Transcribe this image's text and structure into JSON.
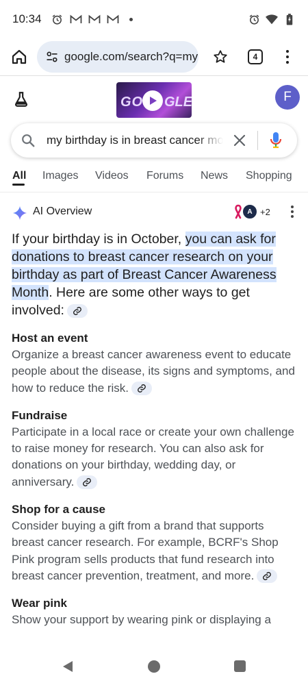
{
  "status_bar": {
    "time": "10:34",
    "left_icons": [
      "alarm-icon",
      "gmail-icon",
      "gmail-icon",
      "gmail-icon",
      "dot-icon"
    ],
    "right_icons": [
      "alarm-icon",
      "wifi-icon",
      "battery-icon"
    ]
  },
  "browser": {
    "url": "google.com/search?q=my",
    "tab_count": "4"
  },
  "header": {
    "avatar_initial": "F",
    "doodle_text_left": "GO",
    "doodle_text_right": "GLE"
  },
  "search": {
    "query": "my birthday is in breast cancer month"
  },
  "tabs": [
    {
      "label": "All",
      "active": true
    },
    {
      "label": "Images",
      "active": false
    },
    {
      "label": "Videos",
      "active": false
    },
    {
      "label": "Forums",
      "active": false
    },
    {
      "label": "News",
      "active": false
    },
    {
      "label": "Shopping",
      "active": false
    }
  ],
  "ai_overview": {
    "title": "AI Overview",
    "source_badge": "A",
    "source_more": "+2",
    "lead_before": "If your birthday is in October, ",
    "lead_highlight": "you can ask for donations to breast cancer research on your birthday as part of Breast Cancer Awareness Month",
    "lead_after": ". Here are some other ways to get involved:",
    "sections": [
      {
        "title": "Host an event",
        "body": "Organize a breast cancer awareness event to educate people about the disease, its signs and symptoms, and how to reduce the risk."
      },
      {
        "title": "Fundraise",
        "body": "Participate in a local race or create your own challenge to raise money for research. You can also ask for donations on your birthday, wedding day, or anniversary."
      },
      {
        "title": "Shop for a cause",
        "body": "Consider buying a gift from a brand that supports breast cancer research. For example, BCRF's Shop Pink program sells products that fund research into breast cancer prevention, treatment, and more."
      },
      {
        "title": "Wear pink",
        "body": "Show your support by wearing pink or displaying a"
      }
    ]
  },
  "colors": {
    "highlight": "#d3e3fd",
    "avatar": "#5d5fc9",
    "url_pill": "#e7edf6"
  }
}
